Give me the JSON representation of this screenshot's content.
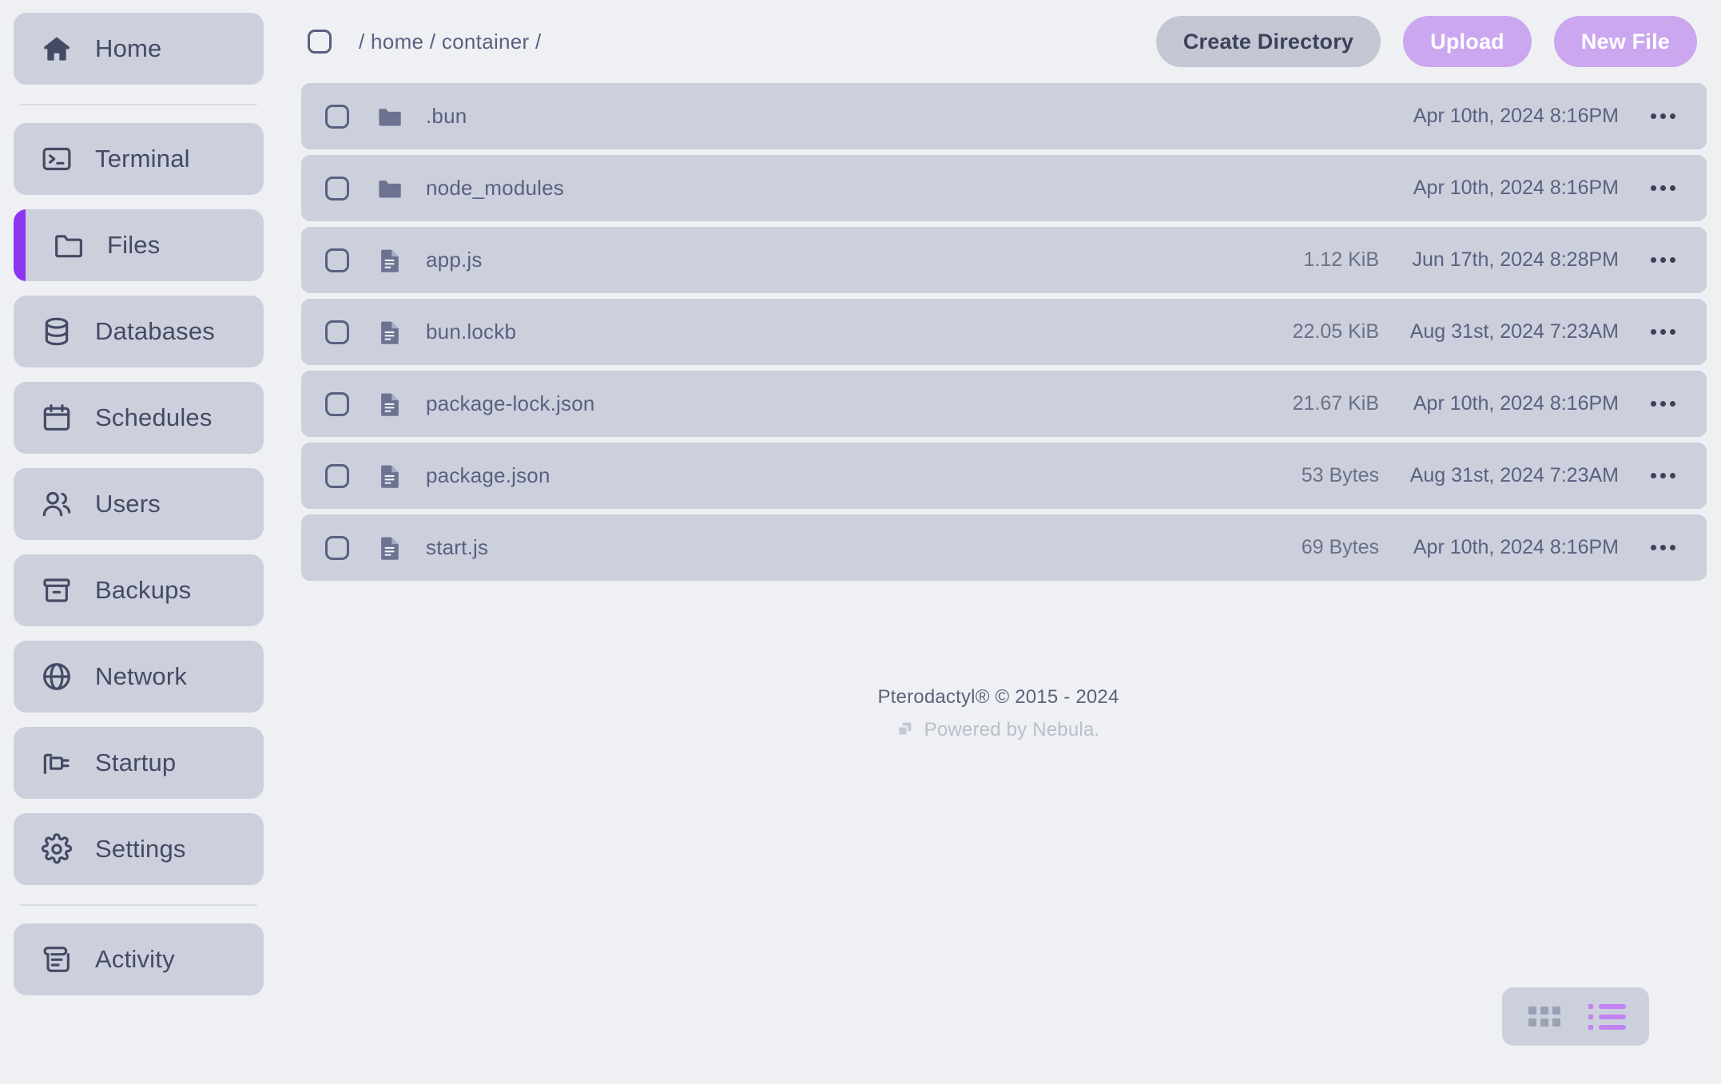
{
  "theme": {
    "page_bg": "#eff0f4",
    "panel_bg": "#ccd0dc",
    "text": "#454a64",
    "muted_text": "#5a6080",
    "accent_purple": "#8b35f2",
    "button_purple": "#cba7f0",
    "button_secondary": "#c3c7d3",
    "footer_muted": "#b9bec9"
  },
  "sidebar": {
    "items": [
      {
        "label": "Home",
        "icon": "home-icon",
        "active": false
      },
      {
        "label": "Terminal",
        "icon": "terminal-icon",
        "active": false
      },
      {
        "label": "Files",
        "icon": "folder-icon",
        "active": true
      },
      {
        "label": "Databases",
        "icon": "database-icon",
        "active": false
      },
      {
        "label": "Schedules",
        "icon": "calendar-icon",
        "active": false
      },
      {
        "label": "Users",
        "icon": "users-icon",
        "active": false
      },
      {
        "label": "Backups",
        "icon": "archive-icon",
        "active": false
      },
      {
        "label": "Network",
        "icon": "globe-icon",
        "active": false
      },
      {
        "label": "Startup",
        "icon": "plug-icon",
        "active": false
      },
      {
        "label": "Settings",
        "icon": "gear-icon",
        "active": false
      },
      {
        "label": "Activity",
        "icon": "scroll-icon",
        "active": false
      }
    ]
  },
  "toolbar": {
    "breadcrumb": "/ home / container /",
    "select_all_checked": false,
    "create_directory_label": "Create Directory",
    "upload_label": "Upload",
    "new_file_label": "New File"
  },
  "files": [
    {
      "name": ".bun",
      "type": "folder",
      "size": "",
      "modified": "Apr 10th, 2024 8:16PM"
    },
    {
      "name": "node_modules",
      "type": "folder",
      "size": "",
      "modified": "Apr 10th, 2024 8:16PM"
    },
    {
      "name": "app.js",
      "type": "file",
      "size": "1.12 KiB",
      "modified": "Jun 17th, 2024 8:28PM"
    },
    {
      "name": "bun.lockb",
      "type": "file",
      "size": "22.05 KiB",
      "modified": "Aug 31st, 2024 7:23AM"
    },
    {
      "name": "package-lock.json",
      "type": "file",
      "size": "21.67 KiB",
      "modified": "Apr 10th, 2024 8:16PM"
    },
    {
      "name": "package.json",
      "type": "file",
      "size": "53 Bytes",
      "modified": "Aug 31st, 2024 7:23AM"
    },
    {
      "name": "start.js",
      "type": "file",
      "size": "69 Bytes",
      "modified": "Apr 10th, 2024 8:16PM"
    }
  ],
  "footer": {
    "copyright": "Pterodactyl® © 2015 - 2024",
    "powered_by": "Powered by Nebula."
  },
  "view_toggle": {
    "grid_label": "grid-view",
    "list_label": "list-view",
    "active": "list"
  }
}
